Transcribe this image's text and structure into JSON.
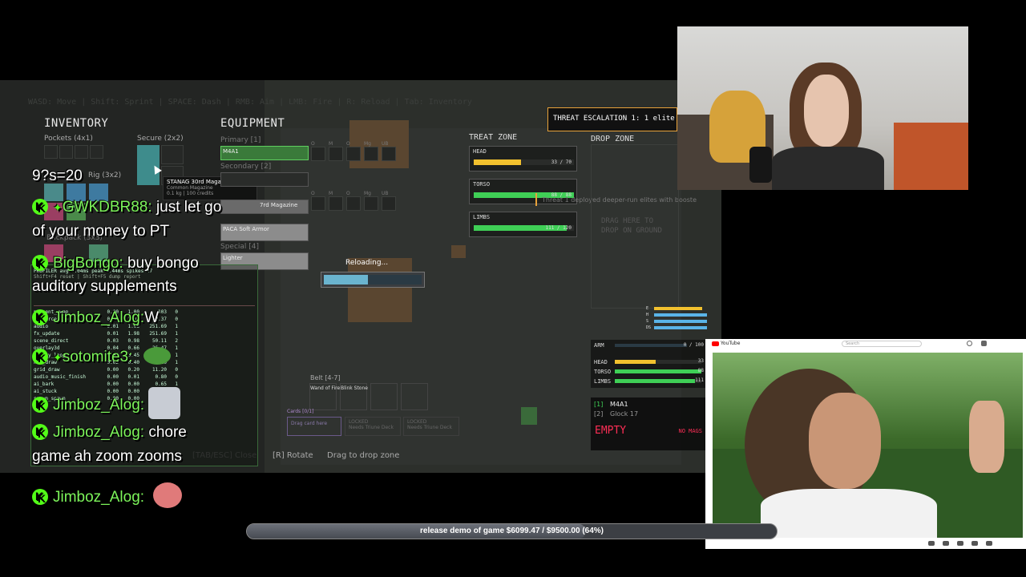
{
  "hud": {
    "controls_hint": "WASD: Move | Shift: Sprint | SPACE: Dash | RMB: Aim | LMB: Fire | R: Reload | Tab: Inventory",
    "inventory_title": "INVENTORY",
    "pockets_label": "Pockets (4x1)",
    "secure_label": "Secure (2x2)",
    "rig_label": "Rig (3x2)",
    "backpack_label": "Backpack (3x3)",
    "tooltip_name": "STANAG 30rd Magazine",
    "tooltip_rarity": "Common Magazine",
    "tooltip_stats": "0.1 kg  |  100 credits",
    "equipment_title": "EQUIPMENT",
    "eq_primary_label": "Primary [1]",
    "eq_primary_item": "M4A1",
    "eq_secondary_label": "Secondary [2]",
    "eq_mag_item": "7rd Magazine",
    "eq_armor_item": "PACA Soft Armor",
    "eq_special_label": "Special [4]",
    "eq_special_item": "Lighter",
    "attach_labels": [
      "O",
      "M",
      "O",
      "Mg",
      "UB"
    ],
    "reloading_text": "Reloading...",
    "reload_progress": 0.45,
    "belt_label": "Belt [4-7]",
    "belt_item_1": "Wand of Fire",
    "belt_item_2": "Blink Stone",
    "cards_label": "Cards [0/1]",
    "cards_drag": "Drag card here",
    "locked_label": "LOCKED",
    "locked_sub": "Needs Triune Deck",
    "bottom_close": "[TAB/ESC] Close",
    "bottom_rotate": "[R] Rotate",
    "bottom_drag": "Drag to drop zone",
    "treat_zone_title": "TREAT ZONE",
    "head_label": "HEAD",
    "head_value": "33 / 70",
    "head_fraction": 0.47,
    "torso_label": "TORSO",
    "torso_value": "88 / 88",
    "torso_fraction": 1.0,
    "limbs_label": "LIMBS",
    "limbs_value": "111 / 120",
    "limbs_fraction": 0.93,
    "threat_title": "THREAT ESCALATION 1: 1 elite",
    "threat_msg": "Threat 1 deployed deeper-run elites with booste",
    "drop_zone_title": "DROP ZONE",
    "drop_zone_hint_1": "DRAG HERE TO",
    "drop_zone_hint_2": "DROP ON GROUND",
    "mini_labels": [
      "E",
      "H",
      "S",
      "DS"
    ],
    "status_arm_label": "ARM",
    "status_arm_value": "0 / 100",
    "status_head_label": "HEAD",
    "status_head_value": "33",
    "status_torso_label": "TORSO",
    "status_torso_value": "88",
    "status_limbs_label": "LIMBS",
    "status_limbs_value": "111",
    "weapon_1_key": "[1]",
    "weapon_1": "M4A1",
    "weapon_2_key": "[2]",
    "weapon_2": "Glock 17",
    "ammo_state": "EMPTY",
    "mags_state": "NO MAGS"
  },
  "chat": {
    "fragment": "9?s=20",
    "messages": [
      {
        "user": "GWKDBR88:",
        "text": "just let go"
      },
      {
        "user": "",
        "text": "of your money to PT"
      },
      {
        "user": "BigBongo:",
        "text": "buy bongo"
      },
      {
        "user": "",
        "text": "auditory supplements"
      },
      {
        "user": "Jimboz_Alog:",
        "text": "W"
      },
      {
        "user": "sotomite3:",
        "text": ""
      },
      {
        "user": "Jimboz_Alog:",
        "text": ""
      },
      {
        "user": "Jimboz_Alog:",
        "text": "chore"
      },
      {
        "user": "",
        "text": "game ah zoom zooms"
      },
      {
        "user": "Jimboz_Alog:",
        "text": ""
      }
    ]
  },
  "profiler": {
    "header": "PROFILER  avg 3.04ms  peak 8.44ms  spikes 17",
    "subheader": "Shift+F4 reset | Shift+F5 dump report",
    "rows": [
      {
        "name": "present_swap",
        "a": "0.00",
        "b": "1.00",
        "c": "103",
        "d": "0"
      },
      {
        "name": "ai_perception",
        "a": "0.00",
        "b": "2.05",
        "c": "40.37",
        "d": "0"
      },
      {
        "name": "audio",
        "a": "0.01",
        "b": "1.98",
        "c": "251.69",
        "d": "1"
      },
      {
        "name": "fx_update",
        "a": "0.01",
        "b": "1.98",
        "c": "251.69",
        "d": "1"
      },
      {
        "name": "scene_direct",
        "a": "0.03",
        "b": "0.98",
        "c": "50.11",
        "d": "2"
      },
      {
        "name": "overlay3d",
        "a": "0.04",
        "b": "0.66",
        "c": "26.47",
        "d": "1"
      },
      {
        "name": "entity_loop",
        "a": "0.01",
        "b": "0.45",
        "c": "26.39",
        "d": "1"
      },
      {
        "name": "hud_draw",
        "a": "0.02",
        "b": "0.40",
        "c": "22.10",
        "d": "1"
      },
      {
        "name": "grid_draw",
        "a": "0.00",
        "b": "0.20",
        "c": "11.20",
        "d": "0"
      },
      {
        "name": "audio_music_finish",
        "a": "0.00",
        "b": "0.01",
        "c": "0.80",
        "d": "0"
      },
      {
        "name": "ai_bark",
        "a": "0.00",
        "b": "0.00",
        "c": "0.65",
        "d": "1"
      },
      {
        "name": "ai_stuck",
        "a": "0.00",
        "b": "0.00",
        "c": "0.02",
        "d": "1"
      },
      {
        "name": "spawn_spawn",
        "a": "0.00",
        "b": "0.00",
        "c": "0.01",
        "d": "0"
      }
    ]
  },
  "youtube": {
    "brand": "YouTube",
    "search": "Search"
  },
  "goal": {
    "text": "release demo of game $6099.47 / $9500.00 (64%)",
    "fraction": 0.64
  },
  "colors": {
    "health_green": "#3fcf56",
    "head_yellow": "#f2c12e",
    "accent_orange": "#e8a23a",
    "empty_red": "#ff2e56",
    "kick_green": "#53fc18",
    "chat_user_green": "#7cf45a"
  }
}
